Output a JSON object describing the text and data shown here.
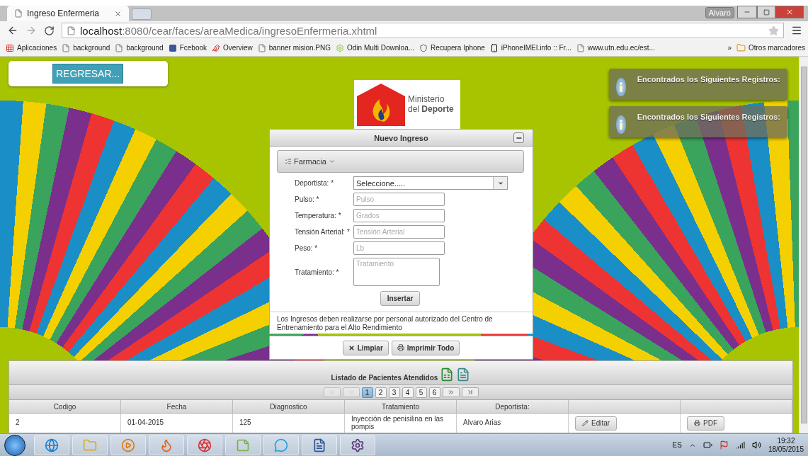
{
  "browser": {
    "tab_title": "Ingreso Enfermeria",
    "profile": "Alvaro",
    "url_host": "localhost",
    "url_path": ":8080/cear/faces/areaMedica/ingresoEnfermeria.xhtml",
    "bookmarks": [
      {
        "kind": "apps",
        "label": "Aplicaciones"
      },
      {
        "kind": "page",
        "label": "background"
      },
      {
        "kind": "page",
        "label": "background"
      },
      {
        "kind": "facebook",
        "label": "Fcebook"
      },
      {
        "kind": "bird",
        "label": "Overview"
      },
      {
        "kind": "page",
        "label": "banner mision.PNG"
      },
      {
        "kind": "android",
        "label": "Odin Multi Downloa..."
      },
      {
        "kind": "shield",
        "label": "Recupera Iphone"
      },
      {
        "kind": "phone",
        "label": "iPhoneIMEI.info :: Fr..."
      },
      {
        "kind": "page",
        "label": "www.utn.edu.ec/est..."
      }
    ],
    "more": "»",
    "other_bookmarks": "Otros marcadores"
  },
  "back_button": "REGRESAR...",
  "logo": {
    "line1": "Ministerio",
    "line2_prefix": "del",
    "line2_bold": "Deporte"
  },
  "notifications": [
    {
      "text": "Encontrados los Siguientes Registros:"
    },
    {
      "text": "Encontrados los Siguientes Registros:"
    }
  ],
  "form": {
    "title": "Nuevo Ingreso",
    "menu": "Farmacia",
    "fields": [
      {
        "kind": "select",
        "label": "Deportista: *",
        "value": "Seleccione....."
      },
      {
        "kind": "text",
        "label": "Pulso: *",
        "placeholder": "Pulso"
      },
      {
        "kind": "text",
        "label": "Temperatura: *",
        "placeholder": "Grados"
      },
      {
        "kind": "text",
        "label": "Tensión Arterial: *",
        "placeholder": "Tensión Arterial"
      },
      {
        "kind": "text",
        "label": "Peso: *",
        "placeholder": "Lb"
      },
      {
        "kind": "textarea",
        "label": "Tratamiento: *",
        "placeholder": "Tratamiento"
      }
    ],
    "submit": "Insertar",
    "note": "Los Ingresos deben realizarse por personal autorizado del Centro de Entrenamiento para el Alto Rendimiento",
    "actions": [
      {
        "kind": "clear",
        "label": "Limpiar"
      },
      {
        "kind": "print",
        "label": "Imprimir Todo"
      }
    ]
  },
  "table": {
    "title": "Listado de Pacientes Atendidos",
    "nav_before": [
      {
        "kind": "first",
        "disabled": true
      },
      {
        "kind": "prev",
        "disabled": true
      }
    ],
    "pages": [
      {
        "label": "1",
        "selected": true
      },
      {
        "label": "2",
        "selected": false
      },
      {
        "label": "3",
        "selected": false
      },
      {
        "label": "4",
        "selected": false
      },
      {
        "label": "5",
        "selected": false
      },
      {
        "label": "6",
        "selected": false
      }
    ],
    "nav_after": [
      {
        "kind": "next",
        "disabled": false
      },
      {
        "kind": "last",
        "disabled": false
      }
    ],
    "columns": [
      "Codigo",
      "Fecha",
      "Diagnostico",
      "Tratamiento",
      "Deportista:"
    ],
    "rows": [
      {
        "cells": [
          "2",
          "01-04-2015",
          "125",
          "Inyección de penisilina en las pompis",
          "Alvaro Arias"
        ],
        "edit": "Editar",
        "pdf": "PDF"
      }
    ]
  },
  "tray": {
    "language": "ES",
    "time": "19:32",
    "date": "18/05/2015"
  }
}
